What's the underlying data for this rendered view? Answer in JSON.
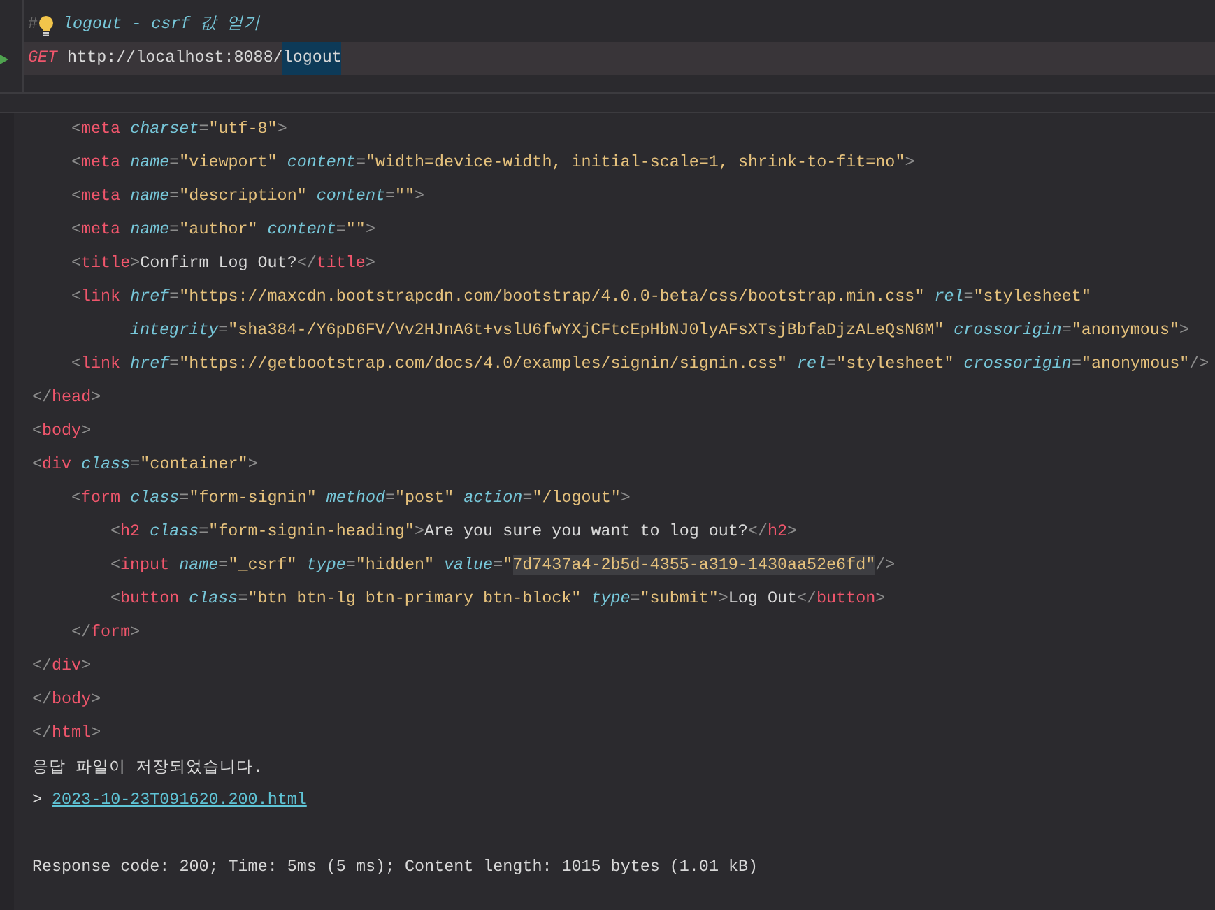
{
  "request": {
    "comment_marker": "#",
    "comment": "logout - csrf 값 얻기",
    "method": "GET",
    "url_parts": [
      {
        "text": "http://localhost:8088/",
        "selected": false
      },
      {
        "text": "logout",
        "selected": true
      }
    ]
  },
  "response_body": [
    {
      "tokens": [
        {
          "kind": "punct",
          "text": "<"
        },
        {
          "kind": "tag",
          "text": "meta "
        },
        {
          "kind": "attr",
          "text": "charset"
        },
        {
          "kind": "punct",
          "text": "="
        },
        {
          "kind": "value",
          "text": "\"utf-8\""
        },
        {
          "kind": "punct",
          "text": ">"
        }
      ]
    },
    {
      "tokens": [
        {
          "kind": "punct",
          "text": "<"
        },
        {
          "kind": "tag",
          "text": "meta "
        },
        {
          "kind": "attr",
          "text": "name"
        },
        {
          "kind": "punct",
          "text": "="
        },
        {
          "kind": "value",
          "text": "\"viewport\" "
        },
        {
          "kind": "attr",
          "text": "content"
        },
        {
          "kind": "punct",
          "text": "="
        },
        {
          "kind": "value",
          "text": "\"width=device-width, initial-scale=1, shrink-to-fit=no\""
        },
        {
          "kind": "punct",
          "text": ">"
        }
      ]
    },
    {
      "tokens": [
        {
          "kind": "punct",
          "text": "<"
        },
        {
          "kind": "tag",
          "text": "meta "
        },
        {
          "kind": "attr",
          "text": "name"
        },
        {
          "kind": "punct",
          "text": "="
        },
        {
          "kind": "value",
          "text": "\"description\" "
        },
        {
          "kind": "attr",
          "text": "content"
        },
        {
          "kind": "punct",
          "text": "="
        },
        {
          "kind": "value",
          "text": "\"\""
        },
        {
          "kind": "punct",
          "text": ">"
        }
      ]
    },
    {
      "tokens": [
        {
          "kind": "punct",
          "text": "<"
        },
        {
          "kind": "tag",
          "text": "meta "
        },
        {
          "kind": "attr",
          "text": "name"
        },
        {
          "kind": "punct",
          "text": "="
        },
        {
          "kind": "value",
          "text": "\"author\" "
        },
        {
          "kind": "attr",
          "text": "content"
        },
        {
          "kind": "punct",
          "text": "="
        },
        {
          "kind": "value",
          "text": "\"\""
        },
        {
          "kind": "punct",
          "text": ">"
        }
      ]
    },
    {
      "tokens": [
        {
          "kind": "punct",
          "text": "<"
        },
        {
          "kind": "tag",
          "text": "title"
        },
        {
          "kind": "punct",
          "text": ">"
        },
        {
          "kind": "plain",
          "text": "Confirm Log Out?"
        },
        {
          "kind": "punct",
          "text": "</"
        },
        {
          "kind": "tag",
          "text": "title"
        },
        {
          "kind": "punct",
          "text": ">"
        }
      ]
    },
    {
      "tokens": [
        {
          "kind": "punct",
          "text": "<"
        },
        {
          "kind": "tag",
          "text": "link "
        },
        {
          "kind": "attr",
          "text": "href"
        },
        {
          "kind": "punct",
          "text": "="
        },
        {
          "kind": "value",
          "text": "\"https://maxcdn.bootstrapcdn.com/bootstrap/4.0.0-beta/css/bootstrap.min.css\" "
        },
        {
          "kind": "attr",
          "text": "rel"
        },
        {
          "kind": "punct",
          "text": "="
        },
        {
          "kind": "value",
          "text": "\"stylesheet\""
        }
      ],
      "children": [
        {
          "kind": "continuation",
          "tokens": [
            {
              "kind": "attr",
              "text": "integrity"
            },
            {
              "kind": "punct",
              "text": "="
            },
            {
              "kind": "value",
              "text": "\"sha384-/Y6pD6FV/Vv2HJnA6t+vslU6fwYXjCFtcEpHbNJ0lyAFsXTsjBbfaDjzALeQsN6M\" "
            },
            {
              "kind": "attr",
              "text": "crossorigin"
            },
            {
              "kind": "punct",
              "text": "="
            },
            {
              "kind": "value",
              "text": "\"anonymous\""
            },
            {
              "kind": "punct",
              "text": ">"
            }
          ]
        }
      ]
    },
    {
      "tokens": [
        {
          "kind": "punct",
          "text": "<"
        },
        {
          "kind": "tag",
          "text": "link "
        },
        {
          "kind": "attr",
          "text": "href"
        },
        {
          "kind": "punct",
          "text": "="
        },
        {
          "kind": "value",
          "text": "\"https://getbootstrap.com/docs/4.0/examples/signin/signin.css\" "
        },
        {
          "kind": "attr",
          "text": "rel"
        },
        {
          "kind": "punct",
          "text": "="
        },
        {
          "kind": "value",
          "text": "\"stylesheet\" "
        },
        {
          "kind": "attr",
          "text": "crossorigin"
        },
        {
          "kind": "punct",
          "text": "="
        },
        {
          "kind": "value",
          "text": "\"anonymous\""
        },
        {
          "kind": "punct",
          "text": "/>"
        }
      ]
    }
  ],
  "response_body_rest": [
    {
      "tokens": [
        {
          "kind": "punct",
          "text": "</"
        },
        {
          "kind": "tag",
          "text": "head"
        },
        {
          "kind": "punct",
          "text": ">"
        }
      ]
    },
    {
      "tokens": [
        {
          "kind": "punct",
          "text": "<"
        },
        {
          "kind": "tag",
          "text": "body"
        },
        {
          "kind": "punct",
          "text": ">"
        }
      ]
    },
    {
      "tokens": [
        {
          "kind": "punct",
          "text": "<"
        },
        {
          "kind": "tag",
          "text": "div "
        },
        {
          "kind": "attr",
          "text": "class"
        },
        {
          "kind": "punct",
          "text": "="
        },
        {
          "kind": "value",
          "text": "\"container\""
        },
        {
          "kind": "punct",
          "text": ">"
        }
      ],
      "children": [
        {
          "tokens": [
            {
              "kind": "punct",
              "text": "<"
            },
            {
              "kind": "tag",
              "text": "form "
            },
            {
              "kind": "attr",
              "text": "class"
            },
            {
              "kind": "punct",
              "text": "="
            },
            {
              "kind": "value",
              "text": "\"form-signin\" "
            },
            {
              "kind": "attr",
              "text": "method"
            },
            {
              "kind": "punct",
              "text": "="
            },
            {
              "kind": "value",
              "text": "\"post\" "
            },
            {
              "kind": "attr",
              "text": "action"
            },
            {
              "kind": "punct",
              "text": "="
            },
            {
              "kind": "value",
              "text": "\"/logout\""
            },
            {
              "kind": "punct",
              "text": ">"
            }
          ],
          "children": [
            {
              "tokens": [
                {
                  "kind": "punct",
                  "text": "<"
                },
                {
                  "kind": "tag",
                  "text": "h2 "
                },
                {
                  "kind": "attr",
                  "text": "class"
                },
                {
                  "kind": "punct",
                  "text": "="
                },
                {
                  "kind": "value",
                  "text": "\"form-signin-heading\""
                },
                {
                  "kind": "punct",
                  "text": ">"
                },
                {
                  "kind": "plain",
                  "text": "Are you sure you want to log out?"
                },
                {
                  "kind": "punct",
                  "text": "</"
                },
                {
                  "kind": "tag",
                  "text": "h2"
                },
                {
                  "kind": "punct",
                  "text": ">"
                }
              ]
            },
            {
              "tokens": [
                {
                  "kind": "punct",
                  "text": "<"
                },
                {
                  "kind": "tag",
                  "text": "input "
                },
                {
                  "kind": "attr",
                  "text": "name"
                },
                {
                  "kind": "punct",
                  "text": "="
                },
                {
                  "kind": "value",
                  "text": "\"_csrf\" "
                },
                {
                  "kind": "attr",
                  "text": "type"
                },
                {
                  "kind": "punct",
                  "text": "="
                },
                {
                  "kind": "value",
                  "text": "\"hidden\" "
                },
                {
                  "kind": "attr",
                  "text": "value"
                },
                {
                  "kind": "punct",
                  "text": "="
                },
                {
                  "kind": "value",
                  "text": "\""
                },
                {
                  "kind": "highlight",
                  "text": "7d7437a4-2b5d-4355-a319-1430aa52e6fd\""
                },
                {
                  "kind": "punct",
                  "text": "/>"
                }
              ]
            },
            {
              "tokens": [
                {
                  "kind": "punct",
                  "text": "<"
                },
                {
                  "kind": "tag",
                  "text": "button "
                },
                {
                  "kind": "attr",
                  "text": "class"
                },
                {
                  "kind": "punct",
                  "text": "="
                },
                {
                  "kind": "value",
                  "text": "\"btn btn-lg btn-primary btn-block\" "
                },
                {
                  "kind": "attr",
                  "text": "type"
                },
                {
                  "kind": "punct",
                  "text": "="
                },
                {
                  "kind": "value",
                  "text": "\"submit\""
                },
                {
                  "kind": "punct",
                  "text": ">"
                },
                {
                  "kind": "plain",
                  "text": "Log Out"
                },
                {
                  "kind": "punct",
                  "text": "</"
                },
                {
                  "kind": "tag",
                  "text": "button"
                },
                {
                  "kind": "punct",
                  "text": ">"
                }
              ]
            }
          ]
        },
        {
          "tokens": [
            {
              "kind": "punct",
              "text": "</"
            },
            {
              "kind": "tag",
              "text": "form"
            },
            {
              "kind": "punct",
              "text": ">"
            }
          ]
        }
      ]
    },
    {
      "tokens": [
        {
          "kind": "punct",
          "text": "</"
        },
        {
          "kind": "tag",
          "text": "div"
        },
        {
          "kind": "punct",
          "text": ">"
        }
      ]
    },
    {
      "tokens": [
        {
          "kind": "punct",
          "text": "</"
        },
        {
          "kind": "tag",
          "text": "body"
        },
        {
          "kind": "punct",
          "text": ">"
        }
      ]
    },
    {
      "tokens": [
        {
          "kind": "punct",
          "text": "</"
        },
        {
          "kind": "tag",
          "text": "html"
        },
        {
          "kind": "punct",
          "text": ">"
        }
      ]
    }
  ],
  "saved_message": "응답 파일이 저장되었습니다.",
  "saved_file": {
    "prompt": ">",
    "link": "2023-10-23T091620.200.html"
  },
  "status_line": "Response code: 200; Time: 5ms (5 ms); Content length: 1015 bytes (1.01 kB)"
}
